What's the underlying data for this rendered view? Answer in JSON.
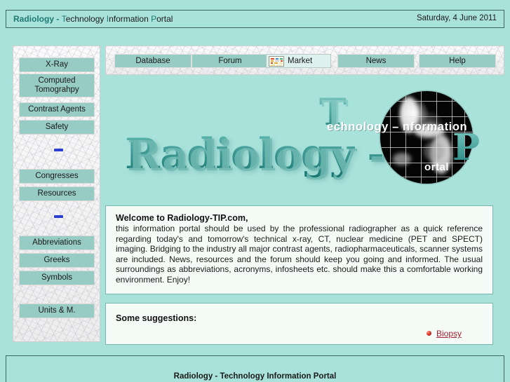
{
  "colors": {
    "page_bg": "#a9e2db",
    "button_teal": "#96ccc3",
    "brand_teal": "#1f7a72",
    "panel_bg": "#f5fcf8",
    "panel_border": "#7ab8af",
    "link_red": "#a32030",
    "separator_blue": "#2b3fd0"
  },
  "header": {
    "brand": "Radiology",
    "dash": " - ",
    "t": "T",
    "word_technology": "echnology ",
    "i": "I",
    "word_information": "nformation ",
    "p": "P",
    "word_portal": "ortal",
    "date": "Saturday, 4 June 2011"
  },
  "sidebar": {
    "items": [
      {
        "label": "X-Ray",
        "name": "sidebar-item-x-ray"
      },
      {
        "label": "Computed Tomograhpy",
        "name": "sidebar-item-computed-tomography"
      },
      {
        "label": "Contrast Agents",
        "name": "sidebar-item-contrast-agents"
      },
      {
        "label": "Safety",
        "name": "sidebar-item-safety"
      },
      {
        "label": "Congresses",
        "name": "sidebar-item-congresses"
      },
      {
        "label": "Resources",
        "name": "sidebar-item-resources"
      },
      {
        "label": "Abbreviations",
        "name": "sidebar-item-abbreviations"
      },
      {
        "label": "Greeks",
        "name": "sidebar-item-greeks"
      },
      {
        "label": "Symbols",
        "name": "sidebar-item-symbols"
      },
      {
        "label": "Units & M.",
        "name": "sidebar-item-units-and-measures"
      }
    ]
  },
  "nav": {
    "tabs": [
      {
        "label": "Database",
        "active": false
      },
      {
        "label": "Forum",
        "active": false
      },
      {
        "label": "Market",
        "active": true,
        "icon": "spreadsheet-icon"
      },
      {
        "label": "News",
        "active": false
      },
      {
        "label": "Help",
        "active": false
      }
    ]
  },
  "banner": {
    "word_radiology": "Radiology -",
    "word_technology": "T",
    "word_portal_letter": "P",
    "overlay_line": "echnology – nformation",
    "overlay_portal": "ortal",
    "globe": "x-ray-phantom-grid-image"
  },
  "welcome": {
    "heading": "Welcome to Radiology-TIP.com,",
    "body": "this information portal should be used by the professional radiographer as a quick reference regarding today's and tomorrow's technical x-ray, CT, nuclear medicine (PET and SPECT) imaging. Bridging to the industry all major contrast agents, radiopharmaceuticals, scanner systems are included. News, resources and the forum should keep you going and informed. The usual surroundings as abbreviations, acronyms, infosheets etc. should make this a comfortable working environment. Enjoy!"
  },
  "suggestions": {
    "heading": "Some suggestions:",
    "link": "Biopsy"
  },
  "footer": {
    "text": "Radiology - Technology Information Portal"
  }
}
